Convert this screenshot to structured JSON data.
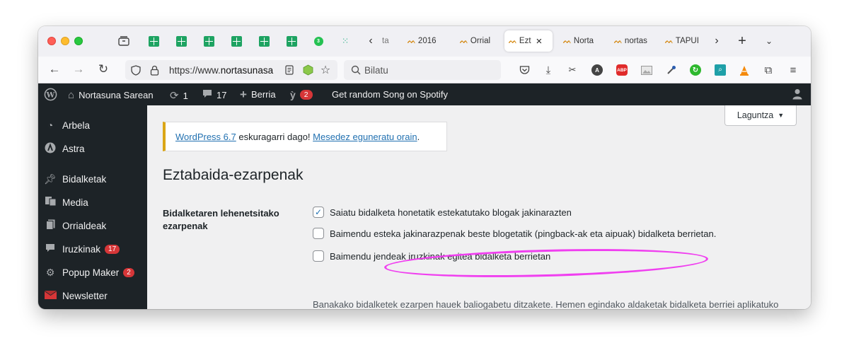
{
  "browser": {
    "tabs": [
      {
        "label": "ta",
        "favicon": "nortasuna-icon"
      },
      {
        "label": "2016",
        "favicon": "nortasuna-icon"
      },
      {
        "label": "Orrial",
        "favicon": "nortasuna-icon"
      },
      {
        "label": "Ezt",
        "favicon": "nortasuna-icon",
        "active": true
      },
      {
        "label": "Norta",
        "favicon": "nortasuna-icon"
      },
      {
        "label": "nortas",
        "favicon": "nortasuna-icon"
      },
      {
        "label": "TAPUI",
        "favicon": "nortasuna-icon"
      }
    ],
    "url": {
      "prefix": "https://www.",
      "host": "nortasunasa"
    },
    "search_placeholder": "Bilatu",
    "extension_badges": {
      "abp": "ABP",
      "a": "A"
    }
  },
  "adminbar": {
    "site_name": "Nortasuna Sarean",
    "updates_count": "1",
    "comments_count": "17",
    "new_label": "Berria",
    "yoast_badge": "2",
    "spotify_label": "Get random Song on Spotify"
  },
  "sidebar": {
    "items": [
      {
        "label": "Arbela",
        "icon": "dashboard-icon"
      },
      {
        "label": "Astra",
        "icon": "astra-icon"
      },
      {
        "label": "Bidalketak",
        "icon": "pin-icon"
      },
      {
        "label": "Media",
        "icon": "media-icon"
      },
      {
        "label": "Orrialdeak",
        "icon": "pages-icon"
      },
      {
        "label": "Iruzkinak",
        "icon": "comments-icon",
        "badge": "17"
      },
      {
        "label": "Popup Maker",
        "icon": "popup-icon",
        "badge": "2"
      },
      {
        "label": "Newsletter",
        "icon": "newsletter-icon"
      }
    ]
  },
  "content": {
    "help_label": "Laguntza",
    "notice": {
      "version_link": "WordPress 6.7",
      "middle_text": " eskuragarri dago! ",
      "update_link": "Mesedez eguneratu orain",
      "end_text": "."
    },
    "page_title": "Eztabaida-ezarpenak",
    "field_label": "Bidalketaren lehenetsitako ezarpenak",
    "options": [
      {
        "label": "Saiatu bidalketa honetatik estekatutako blogak jakinarazten",
        "checked": true
      },
      {
        "label": "Baimendu esteka jakinarazpenak beste blogetatik (pingback-ak eta aipuak) bidalketa berrietan.",
        "checked": false
      },
      {
        "label": "Baimendu jendeak iruzkinak egitea bidalketa berrietan",
        "checked": false
      }
    ],
    "description": "Banakako bidalketek ezarpen hauek baliogabetu ditzakete. Hemen egindako aldaketak bidalketa berriei aplikatuko zaizkie soilik."
  },
  "colors": {
    "admin_dark": "#1d2327",
    "link": "#2271b1",
    "badge_red": "#d63638",
    "notice_yellow": "#dba617",
    "highlight_magenta": "#f03ff0"
  }
}
